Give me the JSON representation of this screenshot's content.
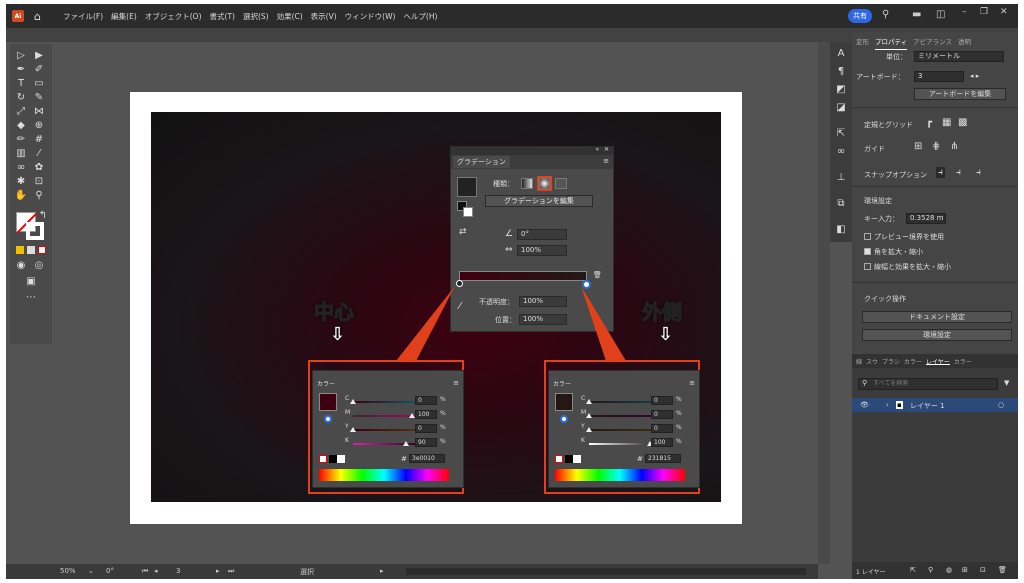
{
  "menubar": {
    "logo": "Ai",
    "items": [
      "ファイル(F)",
      "編集(E)",
      "オブジェクト(O)",
      "書式(T)",
      "選択(S)",
      "効果(C)",
      "表示(V)",
      "ウィンドウ(W)",
      "ヘルプ(H)"
    ],
    "share_label": "共有"
  },
  "gradient_panel": {
    "title": "グラデーション",
    "type_label": "種類：",
    "edit_button": "グラデーションを編集",
    "angle_value": "0°",
    "aspect_value": "100%",
    "opacity_label": "不透明度：",
    "opacity_value": "100%",
    "location_label": "位置：",
    "location_value": "100%"
  },
  "callouts": {
    "center": "中心",
    "outside": "外側"
  },
  "color_panel_center": {
    "title": "カラー",
    "labels": [
      "C",
      "M",
      "Y",
      "K"
    ],
    "values": [
      "0",
      "100",
      "0",
      "90"
    ],
    "unit": "%",
    "hex": "3e0010",
    "swatch": "#3e0010"
  },
  "color_panel_outside": {
    "title": "カラー",
    "labels": [
      "C",
      "M",
      "Y",
      "K"
    ],
    "values": [
      "0",
      "0",
      "0",
      "100"
    ],
    "unit": "%",
    "hex": "231815",
    "swatch": "#231815"
  },
  "right_panel": {
    "tabs": [
      "変形",
      "プロパティ",
      "アピアランス",
      "透明"
    ],
    "unit_label": "単位：",
    "unit_value": "ミリメートル",
    "artboard_label": "アートボード：",
    "artboard_value": "3",
    "artboard_edit_button": "アートボードを編集",
    "ruler_grid_label": "定規とグリッド",
    "guides_label": "ガイド",
    "snap_label": "スナップオプション",
    "prefs_heading": "環境設定",
    "key_input_label": "キー入力：",
    "key_input_value": "0.3528 m",
    "check_preview": "プレビュー境界を使用",
    "check_corners": "角を拡大・縮小",
    "check_strokes": "線幅と効果を拡大・縮小",
    "quick_actions": "クイック操作",
    "doc_settings_button": "ドキュメント設定",
    "prefs_button": "環境設定"
  },
  "layers_panel": {
    "tabs": [
      "線",
      "スウ",
      "ブラシ",
      "カラー",
      "レイヤー",
      "カラー"
    ],
    "search_placeholder": "すべてを検索",
    "layer_name": "レイヤー 1",
    "footer_count": "1 レイヤー"
  },
  "statusbar": {
    "zoom": "50%",
    "rotation": "0°",
    "artboard_num": "3",
    "tool": "選択"
  }
}
